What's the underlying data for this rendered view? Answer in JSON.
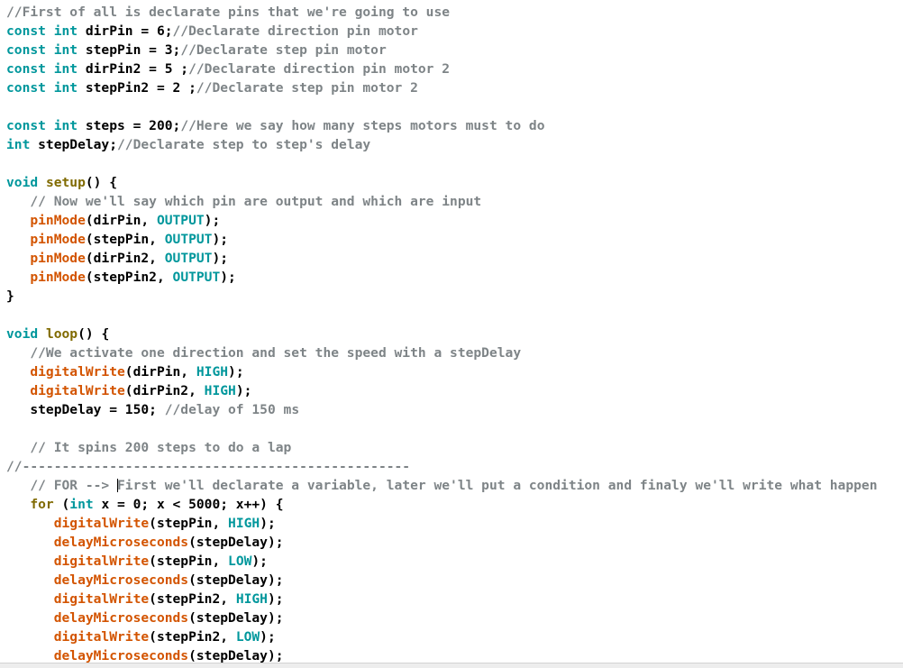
{
  "app": {
    "name": "arduino-ide-code-editor",
    "colors": {
      "background": "#ffffff",
      "text": "#000000",
      "keyword": "#00979C",
      "function": "#D35400",
      "control": "#806A00",
      "literal": "#00979C",
      "comment": "#7E8487",
      "statusbar": "#ededed"
    }
  },
  "statusbar": {
    "text": ""
  },
  "code": {
    "lines": [
      {
        "n": 1,
        "indent": 0,
        "tokens": [
          {
            "t": "cmt",
            "v": "//First of all is declarate pins that we're going to use"
          }
        ]
      },
      {
        "n": 2,
        "indent": 0,
        "tokens": [
          {
            "t": "kw",
            "v": "const int"
          },
          {
            "t": "plain",
            "v": " dirPin = 6;"
          },
          {
            "t": "cmt",
            "v": "//Declarate direction pin motor"
          }
        ]
      },
      {
        "n": 3,
        "indent": 0,
        "tokens": [
          {
            "t": "kw",
            "v": "const int"
          },
          {
            "t": "plain",
            "v": " stepPin = 3;"
          },
          {
            "t": "cmt",
            "v": "//Declarate step pin motor"
          }
        ]
      },
      {
        "n": 4,
        "indent": 0,
        "tokens": [
          {
            "t": "kw",
            "v": "const int"
          },
          {
            "t": "plain",
            "v": " dirPin2 = 5 ;"
          },
          {
            "t": "cmt",
            "v": "//Declarate direction pin motor 2"
          }
        ]
      },
      {
        "n": 5,
        "indent": 0,
        "tokens": [
          {
            "t": "kw",
            "v": "const int"
          },
          {
            "t": "plain",
            "v": " stepPin2 = 2 ;"
          },
          {
            "t": "cmt",
            "v": "//Declarate step pin motor 2"
          }
        ]
      },
      {
        "n": 6,
        "indent": 0,
        "tokens": []
      },
      {
        "n": 7,
        "indent": 0,
        "tokens": [
          {
            "t": "kw",
            "v": "const int"
          },
          {
            "t": "plain",
            "v": " steps = 200;"
          },
          {
            "t": "cmt",
            "v": "//Here we say how many steps motors must to do"
          }
        ]
      },
      {
        "n": 8,
        "indent": 0,
        "tokens": [
          {
            "t": "kw",
            "v": "int"
          },
          {
            "t": "plain",
            "v": " stepDelay;"
          },
          {
            "t": "cmt",
            "v": "//Declarate step to step's delay"
          }
        ]
      },
      {
        "n": 9,
        "indent": 0,
        "tokens": []
      },
      {
        "n": 10,
        "indent": 0,
        "tokens": [
          {
            "t": "kw",
            "v": "void"
          },
          {
            "t": "plain",
            "v": " "
          },
          {
            "t": "ctrl",
            "v": "setup"
          },
          {
            "t": "plain",
            "v": "() {"
          }
        ]
      },
      {
        "n": 11,
        "indent": 1,
        "tokens": [
          {
            "t": "cmt",
            "v": "// Now we'll say which pin are output and which are input"
          }
        ]
      },
      {
        "n": 12,
        "indent": 1,
        "tokens": [
          {
            "t": "fn",
            "v": "pinMode"
          },
          {
            "t": "plain",
            "v": "(dirPin, "
          },
          {
            "t": "lit",
            "v": "OUTPUT"
          },
          {
            "t": "plain",
            "v": ");"
          }
        ]
      },
      {
        "n": 13,
        "indent": 1,
        "tokens": [
          {
            "t": "fn",
            "v": "pinMode"
          },
          {
            "t": "plain",
            "v": "(stepPin, "
          },
          {
            "t": "lit",
            "v": "OUTPUT"
          },
          {
            "t": "plain",
            "v": ");"
          }
        ]
      },
      {
        "n": 14,
        "indent": 1,
        "tokens": [
          {
            "t": "fn",
            "v": "pinMode"
          },
          {
            "t": "plain",
            "v": "(dirPin2, "
          },
          {
            "t": "lit",
            "v": "OUTPUT"
          },
          {
            "t": "plain",
            "v": ");"
          }
        ]
      },
      {
        "n": 15,
        "indent": 1,
        "tokens": [
          {
            "t": "fn",
            "v": "pinMode"
          },
          {
            "t": "plain",
            "v": "(stepPin2, "
          },
          {
            "t": "lit",
            "v": "OUTPUT"
          },
          {
            "t": "plain",
            "v": ");"
          }
        ]
      },
      {
        "n": 16,
        "indent": 0,
        "tokens": [
          {
            "t": "plain",
            "v": "}"
          }
        ]
      },
      {
        "n": 17,
        "indent": 0,
        "tokens": []
      },
      {
        "n": 18,
        "indent": 0,
        "tokens": [
          {
            "t": "kw",
            "v": "void"
          },
          {
            "t": "plain",
            "v": " "
          },
          {
            "t": "ctrl",
            "v": "loop"
          },
          {
            "t": "plain",
            "v": "() {"
          }
        ]
      },
      {
        "n": 19,
        "indent": 1,
        "tokens": [
          {
            "t": "cmt",
            "v": "//We activate one direction and set the speed with a stepDelay"
          }
        ]
      },
      {
        "n": 20,
        "indent": 1,
        "tokens": [
          {
            "t": "fn",
            "v": "digitalWrite"
          },
          {
            "t": "plain",
            "v": "(dirPin, "
          },
          {
            "t": "lit",
            "v": "HIGH"
          },
          {
            "t": "plain",
            "v": ");"
          }
        ]
      },
      {
        "n": 21,
        "indent": 1,
        "tokens": [
          {
            "t": "fn",
            "v": "digitalWrite"
          },
          {
            "t": "plain",
            "v": "(dirPin2, "
          },
          {
            "t": "lit",
            "v": "HIGH"
          },
          {
            "t": "plain",
            "v": ");"
          }
        ]
      },
      {
        "n": 22,
        "indent": 1,
        "tokens": [
          {
            "t": "plain",
            "v": "stepDelay = 150; "
          },
          {
            "t": "cmt",
            "v": "//delay of 150 ms"
          }
        ]
      },
      {
        "n": 23,
        "indent": 0,
        "tokens": []
      },
      {
        "n": 24,
        "indent": 1,
        "tokens": [
          {
            "t": "cmt",
            "v": "// It spins 200 steps to do a lap"
          }
        ]
      },
      {
        "n": 25,
        "indent": 0,
        "tokens": [
          {
            "t": "cmt",
            "v": "//-------------------------------------------------"
          }
        ]
      },
      {
        "n": 26,
        "indent": 1,
        "tokens": [
          {
            "t": "cmt",
            "v": "// FOR --> "
          },
          {
            "t": "caret",
            "v": ""
          },
          {
            "t": "cmt",
            "v": "First we'll declarate a variable, later we'll put a condition and finaly we'll write what happen"
          }
        ]
      },
      {
        "n": 27,
        "indent": 1,
        "tokens": [
          {
            "t": "ctrl",
            "v": "for"
          },
          {
            "t": "plain",
            "v": " ("
          },
          {
            "t": "kw",
            "v": "int"
          },
          {
            "t": "plain",
            "v": " x = 0; x < 5000; x++) {"
          }
        ]
      },
      {
        "n": 28,
        "indent": 2,
        "tokens": [
          {
            "t": "fn",
            "v": "digitalWrite"
          },
          {
            "t": "plain",
            "v": "(stepPin, "
          },
          {
            "t": "lit",
            "v": "HIGH"
          },
          {
            "t": "plain",
            "v": ");"
          }
        ]
      },
      {
        "n": 29,
        "indent": 2,
        "tokens": [
          {
            "t": "fn",
            "v": "delayMicroseconds"
          },
          {
            "t": "plain",
            "v": "(stepDelay);"
          }
        ]
      },
      {
        "n": 30,
        "indent": 2,
        "tokens": [
          {
            "t": "fn",
            "v": "digitalWrite"
          },
          {
            "t": "plain",
            "v": "(stepPin, "
          },
          {
            "t": "lit",
            "v": "LOW"
          },
          {
            "t": "plain",
            "v": ");"
          }
        ]
      },
      {
        "n": 31,
        "indent": 2,
        "tokens": [
          {
            "t": "fn",
            "v": "delayMicroseconds"
          },
          {
            "t": "plain",
            "v": "(stepDelay);"
          }
        ]
      },
      {
        "n": 32,
        "indent": 2,
        "tokens": [
          {
            "t": "fn",
            "v": "digitalWrite"
          },
          {
            "t": "plain",
            "v": "(stepPin2, "
          },
          {
            "t": "lit",
            "v": "HIGH"
          },
          {
            "t": "plain",
            "v": ");"
          }
        ]
      },
      {
        "n": 33,
        "indent": 2,
        "tokens": [
          {
            "t": "fn",
            "v": "delayMicroseconds"
          },
          {
            "t": "plain",
            "v": "(stepDelay);"
          }
        ]
      },
      {
        "n": 34,
        "indent": 2,
        "tokens": [
          {
            "t": "fn",
            "v": "digitalWrite"
          },
          {
            "t": "plain",
            "v": "(stepPin2, "
          },
          {
            "t": "lit",
            "v": "LOW"
          },
          {
            "t": "plain",
            "v": ");"
          }
        ]
      },
      {
        "n": 35,
        "indent": 2,
        "tokens": [
          {
            "t": "fn",
            "v": "delayMicroseconds"
          },
          {
            "t": "plain",
            "v": "(stepDelay);"
          }
        ]
      }
    ]
  }
}
